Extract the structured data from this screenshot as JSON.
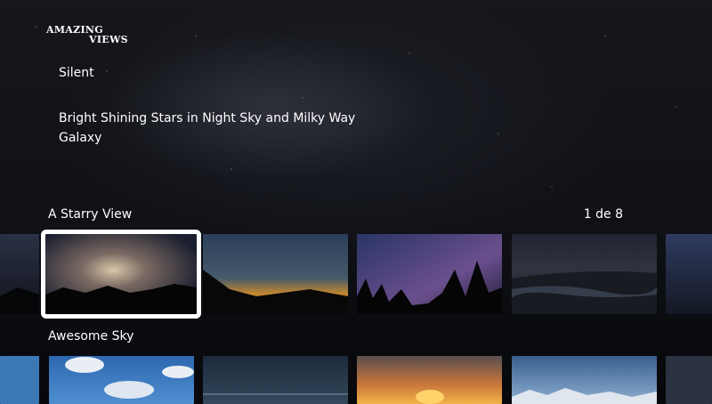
{
  "logo": {
    "line1": "AMAZING",
    "line2": "VIEWS"
  },
  "audio_label": "Silent",
  "description": "Bright Shining Stars in Night Sky and Milky Way Galaxy",
  "rows": [
    {
      "title": "A Starry View",
      "counter": "1 de 8"
    },
    {
      "title": "Awesome Sky"
    }
  ],
  "colors": {
    "selection": "#ffffff",
    "background": "#0f1116"
  }
}
